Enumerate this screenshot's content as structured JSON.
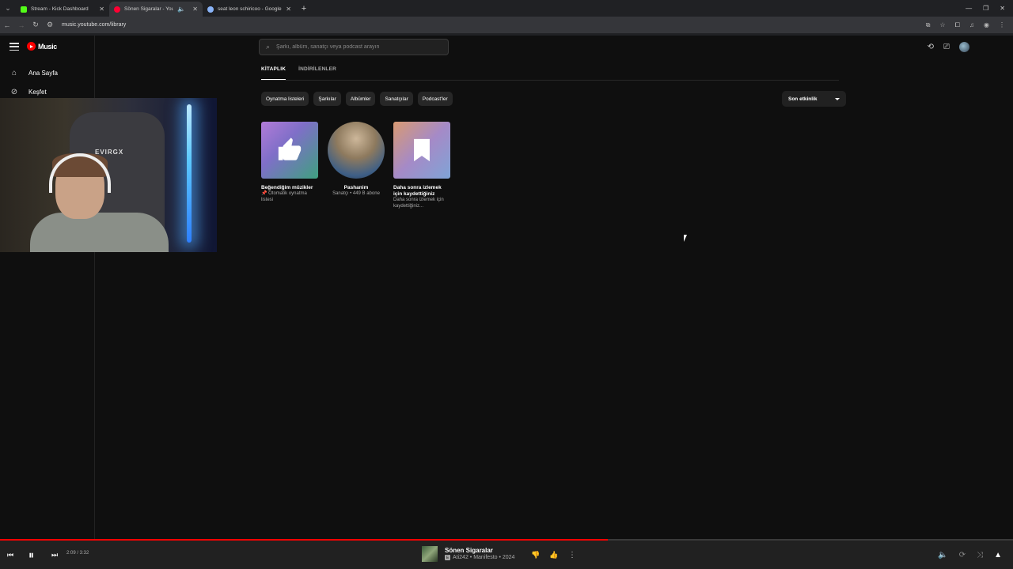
{
  "browser": {
    "tabs": [
      {
        "title": "Stream - Kick Dashboard",
        "favicon_color": "#53fc18"
      },
      {
        "title": "Sönen Sigaralar - YouTube",
        "favicon_color": "#ff0033"
      },
      {
        "title": "seat leon schiricoo - Google'da",
        "favicon_color": "#8ab4f8"
      }
    ],
    "url": "music.youtube.com/library"
  },
  "app": {
    "logo_text": "Music",
    "nav": [
      {
        "label": "Ana Sayfa",
        "icon": "home-icon"
      },
      {
        "label": "Keşfet",
        "icon": "compass-icon"
      }
    ],
    "search_placeholder": "Şarkı, albüm, sanatçı veya podcast arayın"
  },
  "library": {
    "tabs": [
      {
        "label": "KİTAPLIK",
        "active": true
      },
      {
        "label": "İNDİRİLENLER",
        "active": false
      }
    ],
    "chips": [
      "Oynatma listeleri",
      "Şarkılar",
      "Albümler",
      "Sanatçılar",
      "Podcast'ler"
    ],
    "sort_label": "Son etkinlik",
    "cards": [
      {
        "title": "Beğendiğim müzikler",
        "subtitle": "Otomatik oynatma listesi"
      },
      {
        "title": "Pashanim",
        "subtitle": "Sanatçı • 449 B abone"
      },
      {
        "title": "Daha sonra izlemek için kaydettiğiniz",
        "subtitle": "Daha sonra izlemek için kaydettiğiniz..."
      }
    ]
  },
  "webcam": {
    "overlay_text": "EVIRGX"
  },
  "player": {
    "time": "2:09 / 3:32",
    "progress_fraction": 0.6,
    "track_title": "Sönen Sigaralar",
    "track_subtitle": "Ati242 • Manifesto • 2024",
    "accent": "#ff0000"
  }
}
